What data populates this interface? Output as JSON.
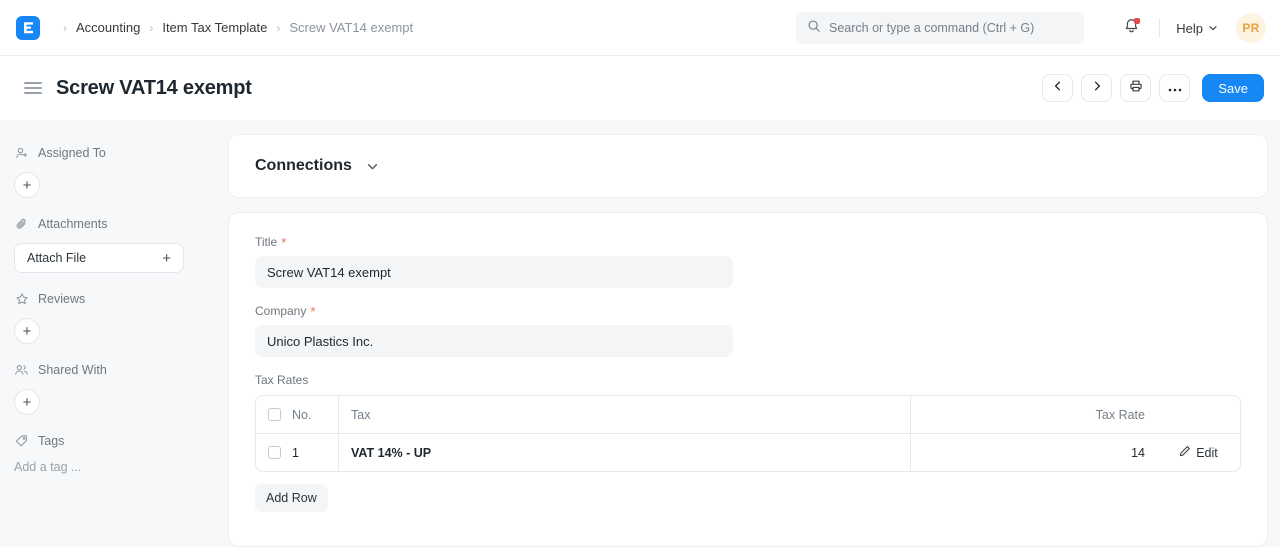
{
  "navbar": {
    "logo_letter": "E",
    "breadcrumbs": [
      {
        "label": "Accounting",
        "current": false
      },
      {
        "label": "Item Tax Template",
        "current": false
      },
      {
        "label": "Screw VAT14 exempt",
        "current": true
      }
    ],
    "separator": "›",
    "search": {
      "placeholder": "Search or type a command (Ctrl + G)",
      "value": ""
    },
    "help_label": "Help",
    "avatar_initials": "PR"
  },
  "page": {
    "title": "Screw VAT14 exempt",
    "save_label": "Save"
  },
  "sidebar": {
    "sections": [
      {
        "label": "Assigned To",
        "icon": "user-plus-icon"
      },
      {
        "label": "Attachments",
        "icon": "paperclip-icon"
      },
      {
        "label": "Reviews",
        "icon": "star-icon"
      },
      {
        "label": "Shared With",
        "icon": "users-icon"
      },
      {
        "label": "Tags",
        "icon": "tag-icon"
      }
    ],
    "attach_file_label": "Attach File",
    "add_tag_label": "Add a tag ..."
  },
  "connections": {
    "title": "Connections"
  },
  "form": {
    "title_field": {
      "label": "Title",
      "value": "Screw VAT14 exempt",
      "required": true
    },
    "company_field": {
      "label": "Company",
      "value": "Unico Plastics Inc.",
      "required": true
    },
    "tax_rates": {
      "label": "Tax Rates",
      "columns": [
        "No.",
        "Tax",
        "Tax Rate"
      ],
      "rows": [
        {
          "no": "1",
          "tax": "VAT 14% - UP",
          "rate": "14",
          "edit_label": "Edit"
        }
      ],
      "add_row_label": "Add Row"
    }
  },
  "colors": {
    "accent": "#1787f5",
    "page_bg": "#f7f8f9",
    "card_bg": "#ffffff",
    "required": "#f0705a",
    "notification": "#e24c4c",
    "avatar_bg": "#fdf3e1",
    "avatar_fg": "#e9a23b"
  }
}
